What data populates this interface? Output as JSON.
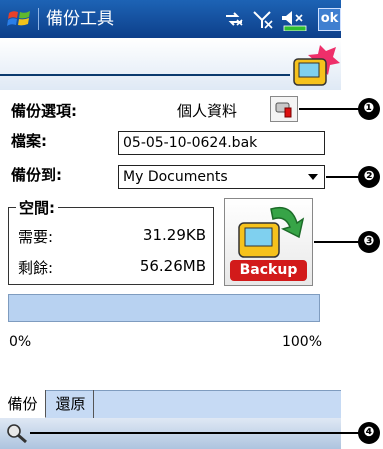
{
  "title_bar": {
    "title": "備份工具",
    "ok_label": "ok"
  },
  "form": {
    "backup_item_label": "備份選項:",
    "backup_item_value": "個人資料",
    "file_label": "檔案:",
    "file_value": "05-05-10-0624.bak",
    "backup_to_label": "備份到:",
    "backup_to_value": "My Documents"
  },
  "space": {
    "group_label": "空間:",
    "required_label": "需要:",
    "required_value": "31.29KB",
    "remaining_label": "剩餘:",
    "remaining_value": "56.26MB"
  },
  "backup_button": {
    "label": "Backup"
  },
  "progress": {
    "min_label": "0%",
    "max_label": "100%",
    "fraction": 0
  },
  "tabs": [
    {
      "label": "備份",
      "active": true
    },
    {
      "label": "還原",
      "active": false
    }
  ],
  "callouts": [
    "❶",
    "❷",
    "❸",
    "❹"
  ],
  "colors": {
    "title_bar": "#1557a8",
    "progress_bar": "#b8d2f1",
    "tab_bar": "#c6daf4",
    "backup_text": "#d21a1a"
  },
  "icons": {
    "start": "windows-flag-icon",
    "connectivity": "connectivity-icon",
    "signal": "signal-off-icon",
    "volume": "speaker-mute-icon",
    "battery": "battery-icon",
    "banner": "backup-tool-icon",
    "item_select": "tool-picker-icon",
    "dropdown": "chevron-down-icon",
    "keyboard": "input-panel-icon"
  }
}
